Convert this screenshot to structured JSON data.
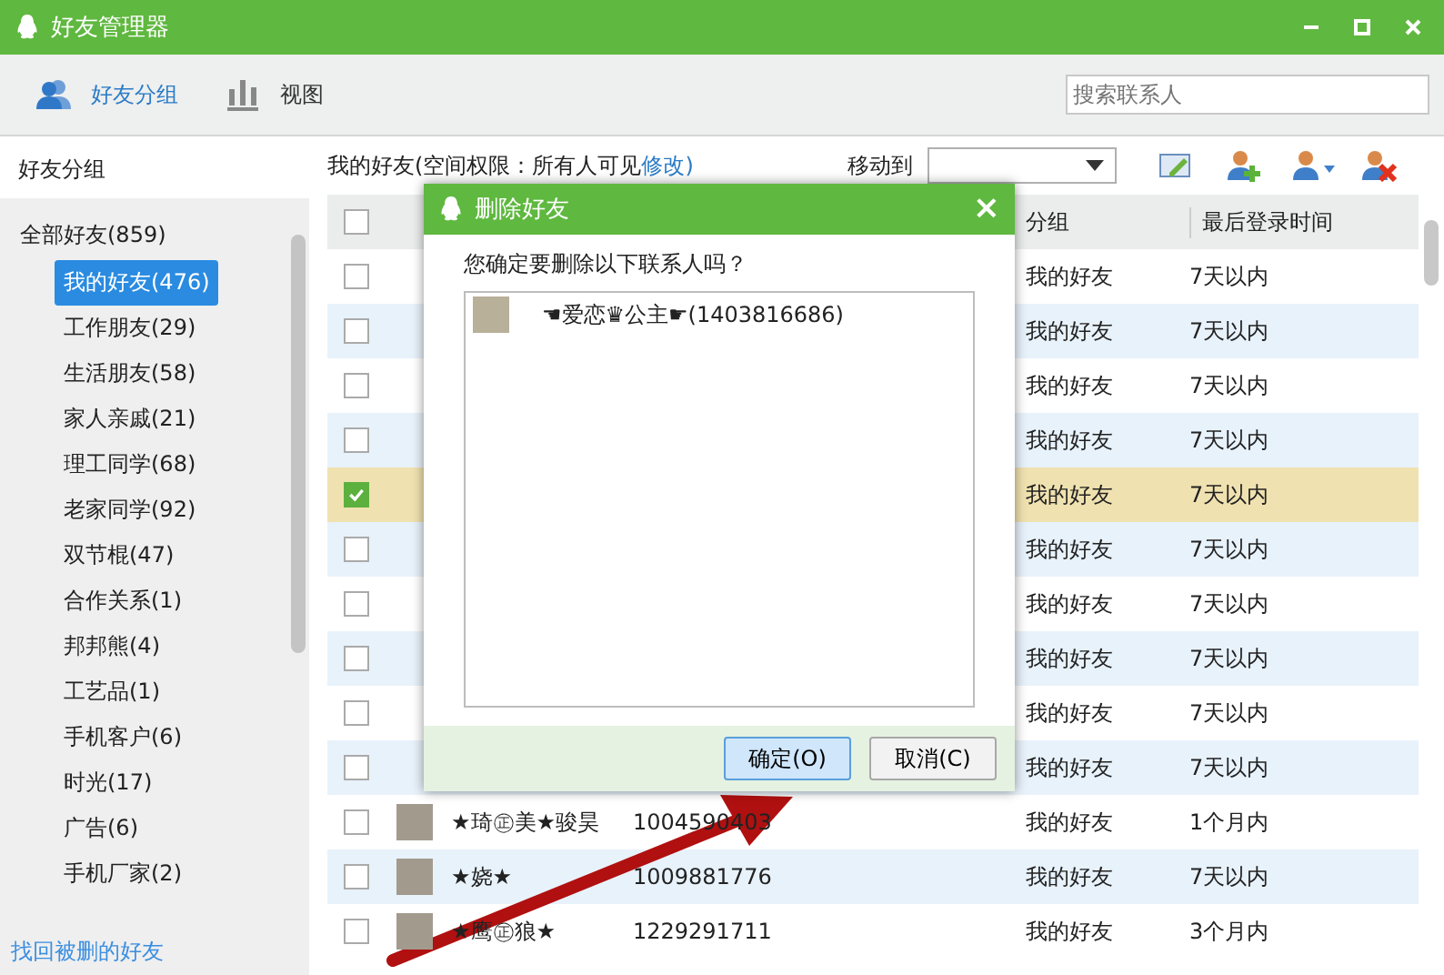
{
  "window": {
    "title": "好友管理器"
  },
  "toolbar": {
    "tabs": [
      {
        "label": "好友分组",
        "selected": true
      },
      {
        "label": "视图",
        "selected": false
      }
    ],
    "search": {
      "placeholder": "搜索联系人"
    }
  },
  "sidebar": {
    "title": "好友分组",
    "root": {
      "label": "全部好友(859)",
      "children": [
        {
          "label": "我的好友(476)",
          "selected": true
        },
        {
          "label": "工作朋友(29)",
          "selected": false
        },
        {
          "label": "生活朋友(58)",
          "selected": false
        },
        {
          "label": "家人亲戚(21)",
          "selected": false
        },
        {
          "label": "理工同学(68)",
          "selected": false
        },
        {
          "label": "老家同学(92)",
          "selected": false
        },
        {
          "label": "双节棍(47)",
          "selected": false
        },
        {
          "label": "合作关系(1)",
          "selected": false
        },
        {
          "label": "邦邦熊(4)",
          "selected": false
        },
        {
          "label": "工艺品(1)",
          "selected": false
        },
        {
          "label": "手机客户(6)",
          "selected": false
        },
        {
          "label": "时光(17)",
          "selected": false
        },
        {
          "label": "广告(6)",
          "selected": false
        },
        {
          "label": "手机厂家(2)",
          "selected": false
        }
      ]
    },
    "link": "找回被删的好友"
  },
  "content": {
    "heading": "我的好友(空间权限：所有人可见",
    "heading_link": "修改)",
    "move_label": "移动到",
    "select_all_checked": false,
    "columns": [
      "分组",
      "最后登录时间"
    ],
    "rows": [
      {
        "checked": false,
        "group": "我的好友",
        "time": "7天以内"
      },
      {
        "checked": false,
        "group": "我的好友",
        "time": "7天以内"
      },
      {
        "checked": false,
        "group": "我的好友",
        "time": "7天以内"
      },
      {
        "checked": false,
        "group": "我的好友",
        "time": "7天以内"
      },
      {
        "checked": true,
        "group": "我的好友",
        "time": "7天以内"
      },
      {
        "checked": false,
        "group": "我的好友",
        "time": "7天以内"
      },
      {
        "checked": false,
        "group": "我的好友",
        "time": "7天以内"
      },
      {
        "checked": false,
        "group": "我的好友",
        "time": "7天以内"
      },
      {
        "checked": false,
        "group": "我的好友",
        "time": "7天以内"
      },
      {
        "checked": false,
        "group": "我的好友",
        "time": "7天以内"
      },
      {
        "checked": false,
        "name": "★琦㊣美★骏昊",
        "number": "1004590403",
        "group": "我的好友",
        "time": "1个月内"
      },
      {
        "checked": false,
        "name": "★娆★",
        "number": "1009881776",
        "group": "我的好友",
        "time": "7天以内"
      },
      {
        "checked": false,
        "name": "★鹰㊣狼★",
        "number": "1229291711",
        "group": "我的好友",
        "time": "3个月内"
      }
    ]
  },
  "dialog": {
    "title": "删除好友",
    "close": "×",
    "question": "您确定要删除以下联系人吗？",
    "contacts": [
      "☚爱恋♛公主☛(1403816686)"
    ],
    "buttons": [
      {
        "label": "确定(O)",
        "default": true
      },
      {
        "label": "取消(C)",
        "default": false
      }
    ]
  }
}
